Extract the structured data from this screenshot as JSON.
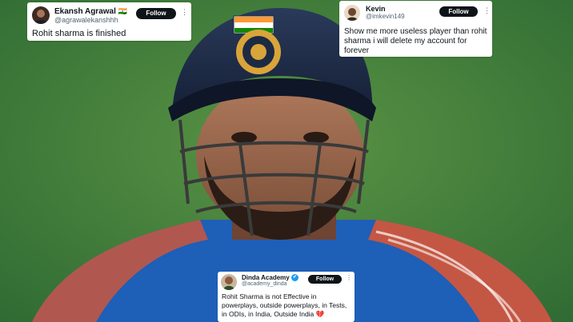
{
  "tweets": [
    {
      "name": "Ekansh Agrawal",
      "flag": "🇮🇳",
      "handle": "@agrawalekanshhh",
      "follow_label": "Follow",
      "more_label": "⋮",
      "text": "Rohit sharma is finished"
    },
    {
      "name": "Kevin",
      "handle": "@imkevin149",
      "follow_label": "Follow",
      "more_label": "⋮",
      "text": "Show me more useless player than rohit sharma i will delete my account for forever"
    },
    {
      "name": "Dinda Academy",
      "verified": "✔",
      "handle": "@academy_dinda",
      "follow_label": "Follow",
      "more_label": "⋮",
      "text": "Rohit Sharma is not Effective in powerplays, outside powerplays, in Tests, in ODIs, in India, Outside India 💔"
    }
  ],
  "colors": {
    "follow_bg": "#0f1419",
    "handle_text": "#536471",
    "verified_blue": "#1d9bf0",
    "field_green": "#3f7a3c",
    "helmet_navy": "#1c2a44",
    "jersey_blue": "#1e5fb8"
  }
}
